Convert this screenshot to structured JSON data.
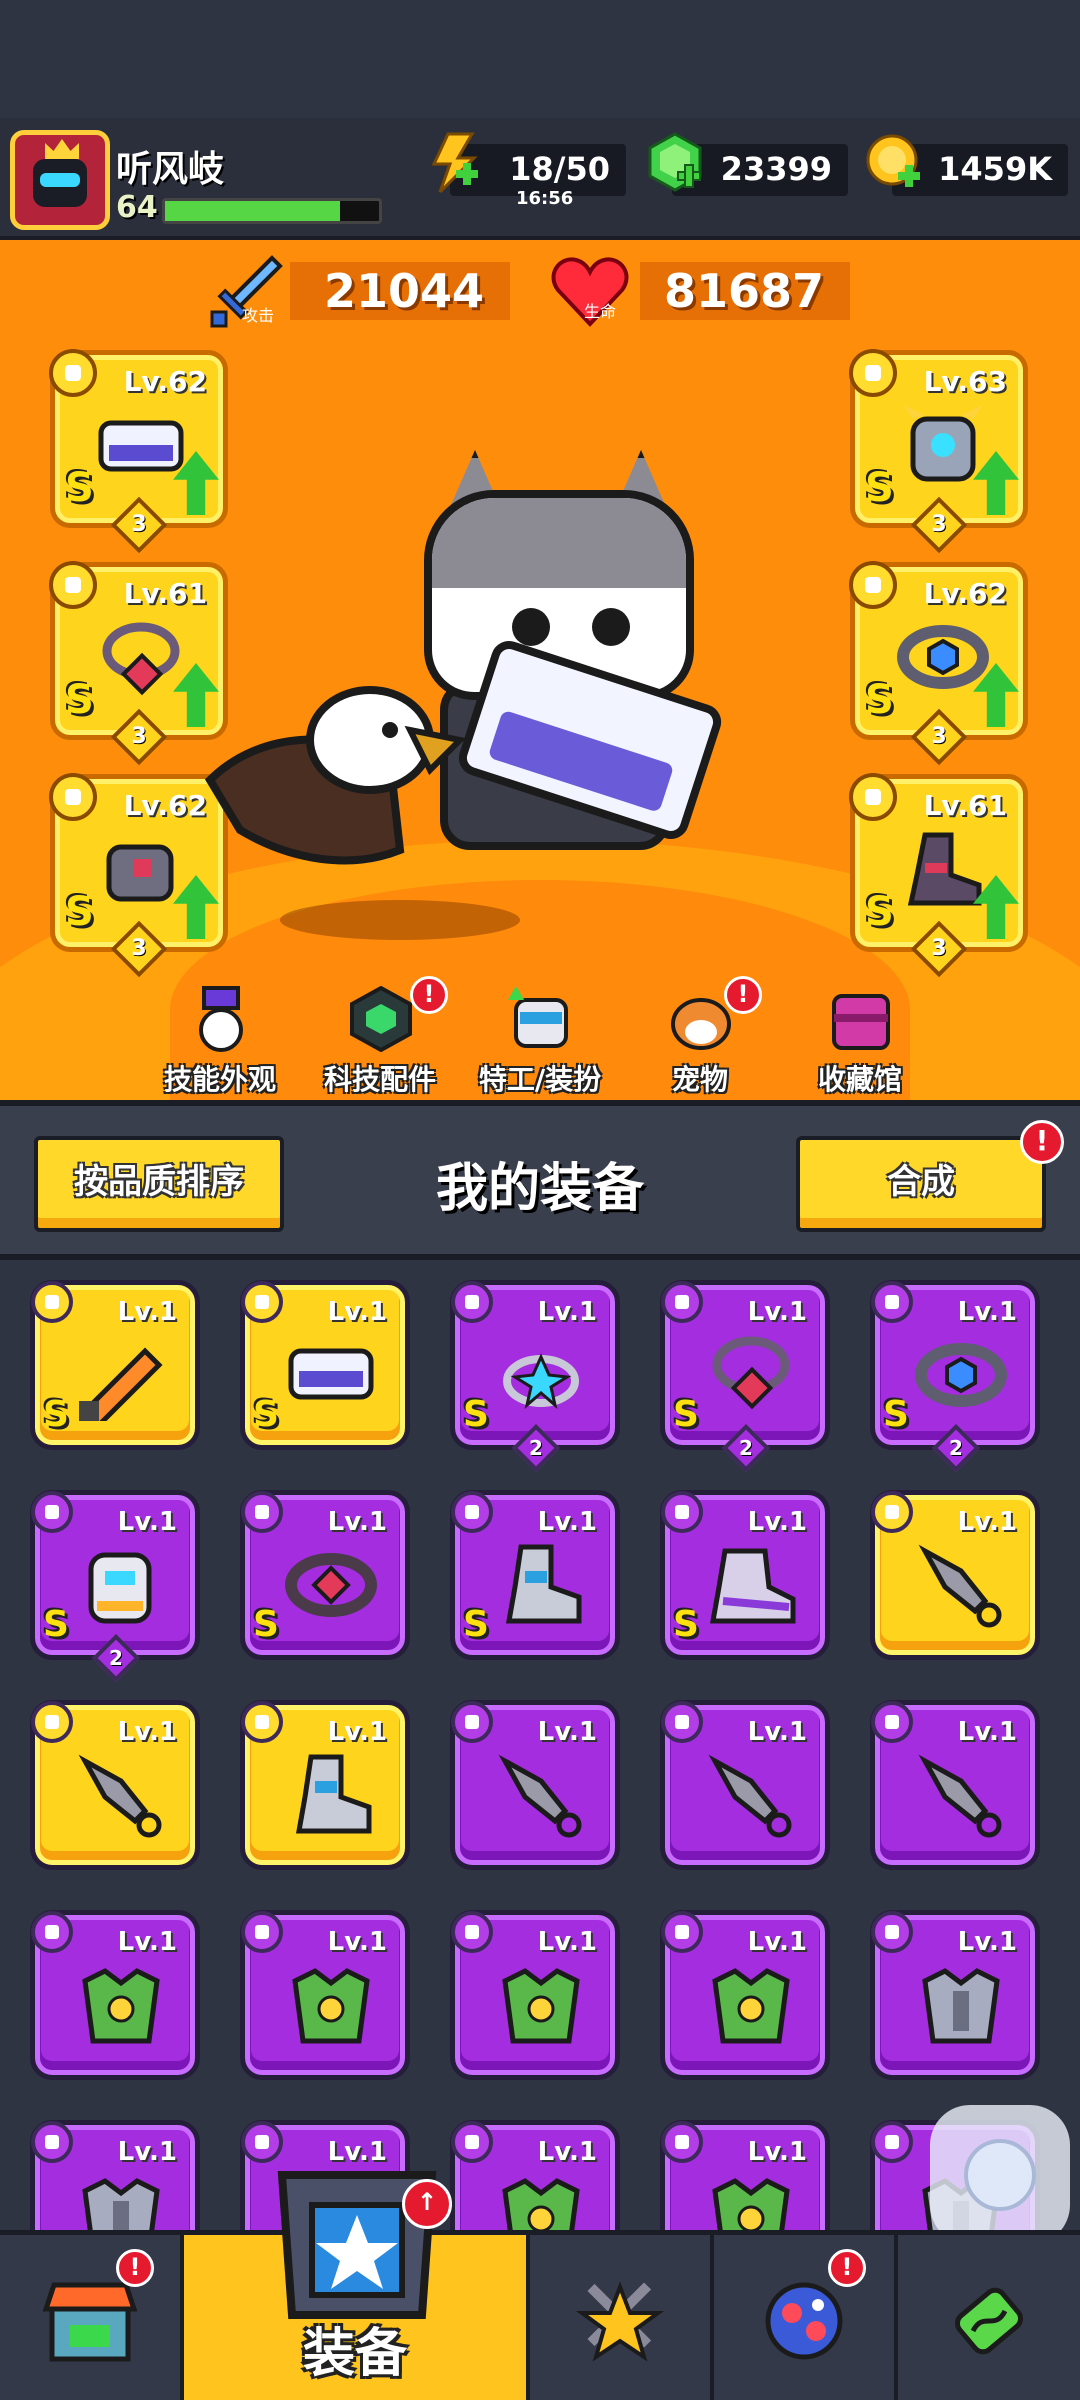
{
  "player": {
    "name": "听风岐",
    "level": "64",
    "xp_fraction": 0.82
  },
  "resources": {
    "energy_value": "18/50",
    "energy_timer": "16:56",
    "gems": "23399",
    "coins": "1459K"
  },
  "stats": {
    "attack_label": "攻击",
    "attack_value": "21044",
    "hp_label": "生命",
    "hp_value": "81687"
  },
  "equipped": {
    "left": [
      {
        "level": "Lv.62",
        "rank": "S",
        "stars": "3",
        "type": "weapon"
      },
      {
        "level": "Lv.61",
        "rank": "S",
        "stars": "3",
        "type": "necklace"
      },
      {
        "level": "Lv.62",
        "rank": "S",
        "stars": "3",
        "type": "glove"
      }
    ],
    "right": [
      {
        "level": "Lv.63",
        "rank": "S",
        "stars": "3",
        "type": "armor"
      },
      {
        "level": "Lv.62",
        "rank": "S",
        "stars": "3",
        "type": "belt"
      },
      {
        "level": "Lv.61",
        "rank": "S",
        "stars": "3",
        "type": "boots"
      }
    ]
  },
  "submenu": [
    {
      "label": "技能外观",
      "badge": false
    },
    {
      "label": "科技配件",
      "badge": true
    },
    {
      "label": "特工/装扮",
      "badge": false
    },
    {
      "label": "宠物",
      "badge": true
    },
    {
      "label": "收藏馆",
      "badge": false
    }
  ],
  "equipment_section": {
    "sort_label": "按品质排序",
    "title": "我的装备",
    "merge_label": "合成",
    "badge": "!"
  },
  "inventory": [
    {
      "level": "Lv.1",
      "rarity": "gold",
      "rank": "S",
      "stars": "",
      "type": "weapon",
      "icon": "sword-icon"
    },
    {
      "level": "Lv.1",
      "rarity": "gold",
      "rank": "S",
      "stars": "",
      "type": "weapon",
      "icon": "blaster-icon"
    },
    {
      "level": "Lv.1",
      "rarity": "purple",
      "rank": "S",
      "stars": "2",
      "type": "necklace",
      "icon": "ring-icon"
    },
    {
      "level": "Lv.1",
      "rarity": "purple",
      "rank": "S",
      "stars": "2",
      "type": "necklace",
      "icon": "chain-necklace-icon"
    },
    {
      "level": "Lv.1",
      "rarity": "purple",
      "rank": "S",
      "stars": "2",
      "type": "belt",
      "icon": "belt-icon"
    },
    {
      "level": "Lv.1",
      "rarity": "purple",
      "rank": "S",
      "stars": "2",
      "type": "glove",
      "icon": "gauntlet-icon"
    },
    {
      "level": "Lv.1",
      "rarity": "purple",
      "rank": "S",
      "stars": "",
      "type": "belt",
      "icon": "gem-belt-icon"
    },
    {
      "level": "Lv.1",
      "rarity": "purple",
      "rank": "S",
      "stars": "",
      "type": "boots",
      "icon": "boot-icon"
    },
    {
      "level": "Lv.1",
      "rarity": "purple",
      "rank": "S",
      "stars": "",
      "type": "boots",
      "icon": "sneaker-icon"
    },
    {
      "level": "Lv.1",
      "rarity": "gold",
      "rank": "",
      "stars": "",
      "type": "weapon",
      "icon": "kunai-icon"
    },
    {
      "level": "Lv.1",
      "rarity": "gold",
      "rank": "",
      "stars": "",
      "type": "weapon",
      "icon": "kunai-icon"
    },
    {
      "level": "Lv.1",
      "rarity": "gold",
      "rank": "",
      "stars": "",
      "type": "boots",
      "icon": "boot-icon"
    },
    {
      "level": "Lv.1",
      "rarity": "purple",
      "rank": "",
      "stars": "",
      "type": "weapon",
      "icon": "kunai-icon"
    },
    {
      "level": "Lv.1",
      "rarity": "purple",
      "rank": "",
      "stars": "",
      "type": "weapon",
      "icon": "kunai-icon"
    },
    {
      "level": "Lv.1",
      "rarity": "purple",
      "rank": "",
      "stars": "",
      "type": "weapon",
      "icon": "kunai-icon"
    },
    {
      "level": "Lv.1",
      "rarity": "purple",
      "rank": "",
      "stars": "",
      "type": "armor",
      "icon": "green-armor-icon"
    },
    {
      "level": "Lv.1",
      "rarity": "purple",
      "rank": "",
      "stars": "",
      "type": "armor",
      "icon": "green-armor-icon"
    },
    {
      "level": "Lv.1",
      "rarity": "purple",
      "rank": "",
      "stars": "",
      "type": "armor",
      "icon": "green-armor-icon"
    },
    {
      "level": "Lv.1",
      "rarity": "purple",
      "rank": "",
      "stars": "",
      "type": "armor",
      "icon": "green-armor-icon"
    },
    {
      "level": "Lv.1",
      "rarity": "purple",
      "rank": "",
      "stars": "",
      "type": "armor",
      "icon": "steel-armor-icon"
    },
    {
      "level": "Lv.1",
      "rarity": "purple",
      "rank": "",
      "stars": "",
      "type": "armor",
      "icon": "steel-armor-icon"
    },
    {
      "level": "Lv.1",
      "rarity": "purple",
      "rank": "",
      "stars": "",
      "type": "armor",
      "icon": "steel-armor-icon"
    },
    {
      "level": "Lv.1",
      "rarity": "purple",
      "rank": "",
      "stars": "",
      "type": "armor",
      "icon": "green-armor-icon"
    },
    {
      "level": "Lv.1",
      "rarity": "purple",
      "rank": "",
      "stars": "",
      "type": "armor",
      "icon": "green-armor-icon"
    },
    {
      "level": "",
      "rarity": "purple",
      "rank": "",
      "stars": "",
      "type": "armor",
      "icon": "steel-armor-icon"
    }
  ],
  "nav": [
    {
      "name": "shop",
      "icon": "shop-icon",
      "badge": true,
      "label": ""
    },
    {
      "name": "equipment",
      "icon": "equipment-icon",
      "badge": false,
      "label": "装备",
      "active": true
    },
    {
      "name": "battle",
      "icon": "battle-star-icon",
      "badge": false,
      "label": ""
    },
    {
      "name": "talent",
      "icon": "planet-icon",
      "badge": true,
      "label": ""
    },
    {
      "name": "evolve",
      "icon": "dna-icon",
      "badge": false,
      "label": ""
    }
  ],
  "colors": {
    "gold_tile": "#ffd41d",
    "purple_tile": "#a42de0",
    "scene_orange": "#ff8d0c",
    "badge_red": "#e51a2e",
    "xp_green": "#56d645"
  }
}
